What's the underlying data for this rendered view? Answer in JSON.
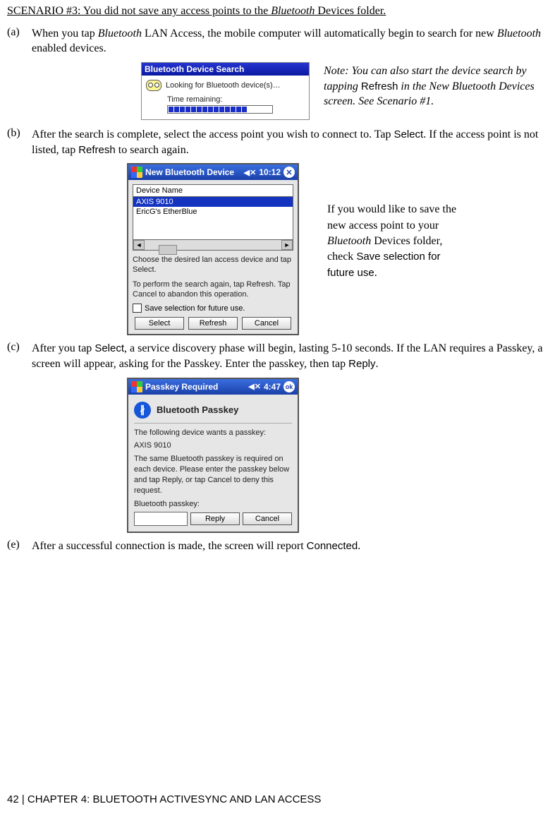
{
  "scenario": {
    "label_prefix": "SCENARIO #3: You did not save any access points to the ",
    "italic_word": "Bluetooth",
    "label_suffix": " Devices folder."
  },
  "step_a": {
    "letter": "(a)",
    "t1": "When you tap ",
    "i1": "Bluetooth",
    "t2": " LAN Access, the mobile computer will automatically begin to search for new ",
    "i2": "Bluetooth",
    "t3": " enabled devices."
  },
  "figA": {
    "title": "Bluetooth Device Search",
    "line1": "Looking for Bluetooth device(s)…",
    "line2": "Time remaining:",
    "note_t1": "Note: You can also start the device search by tapping ",
    "note_b1": "Refresh",
    "note_t2": " in the New Bluetooth Devices screen. See Scenario #1."
  },
  "step_b": {
    "letter": "(b)",
    "t1": "After the search is complete, select the access point you wish to connect to.  Tap ",
    "b1": "Select",
    "t2": ". If the access point is not listed, tap ",
    "b2": "Refresh",
    "t3": " to search again."
  },
  "figB": {
    "title": "New Bluetooth Device",
    "time": "10:12",
    "col_header": "Device Name",
    "item_selected": "AXIS 9010",
    "item_2": "EricG's EtherBlue",
    "para1": "Choose the desired lan access device and tap Select.",
    "para2": "To perform the search again, tap Refresh. Tap Cancel to abandon this operation.",
    "checkbox_label": "Save selection for future use.",
    "btn_select": "Select",
    "btn_refresh": "Refresh",
    "btn_cancel": "Cancel",
    "note_t1": "If you would like to save the new access point to your ",
    "note_i1": "Bluetooth",
    "note_t2": " Devices folder, check ",
    "note_b1": "Save selection for future use",
    "note_t3": "."
  },
  "step_c": {
    "letter": "(c)",
    "t1": "After you tap ",
    "b1": "Select",
    "t2": ", a service discovery phase will begin, lasting 5-10 seconds. If the LAN requires a Passkey, a screen will appear, asking for the Passkey. Enter the passkey, then tap ",
    "b2": "Reply",
    "t3": "."
  },
  "figC": {
    "title": "Passkey Required",
    "time": "4:47",
    "ok": "ok",
    "header": "Bluetooth Passkey",
    "line1": "The following device wants a passkey:",
    "device": "AXIS 9010",
    "para": "The same Bluetooth passkey is required on each device. Please enter the passkey below and tap Reply, or tap Cancel to deny this request.",
    "label": "Bluetooth passkey:",
    "btn_reply": "Reply",
    "btn_cancel": "Cancel"
  },
  "step_e": {
    "letter": "(e)",
    "t1": "After a successful connection is made, the screen will report ",
    "b1": "Connected",
    "t2": "."
  },
  "footer": {
    "page": "42",
    "sep": "  | ",
    "chapter": "CHAPTER 4: BLUETOOTH ACTIVESYNC AND LAN ACCESS"
  }
}
